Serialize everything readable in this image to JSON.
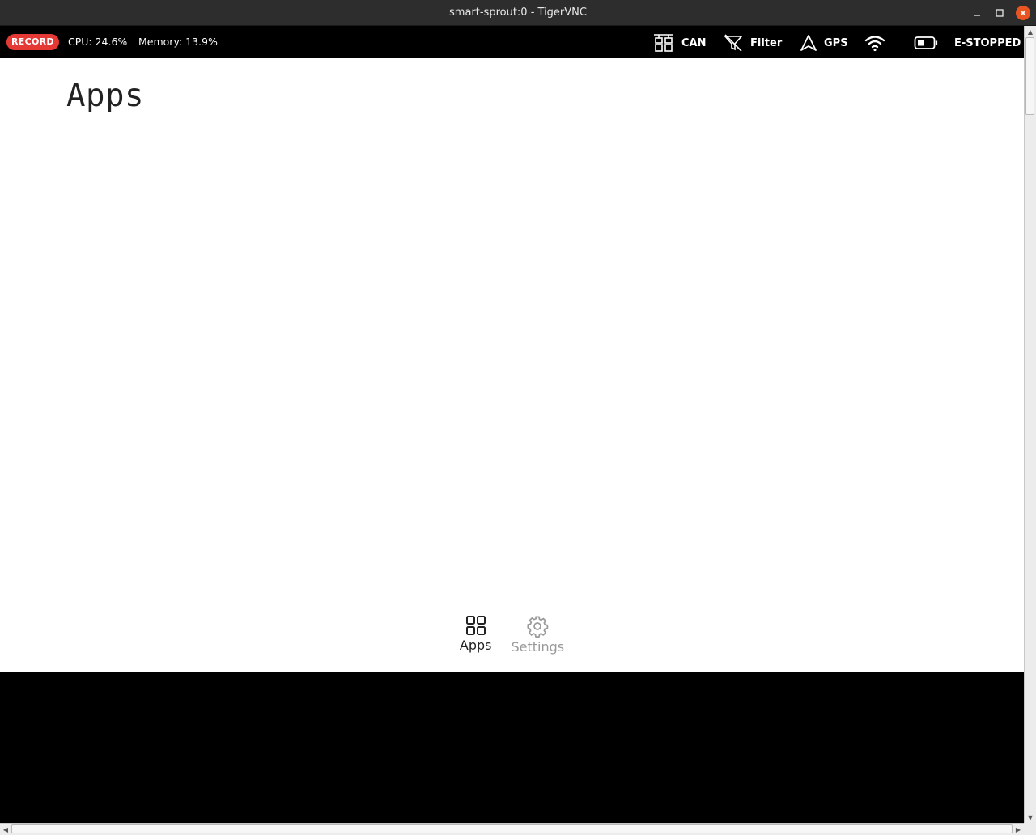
{
  "window": {
    "title": "smart-sprout:0 - TigerVNC"
  },
  "status_bar": {
    "record_label": "RECORD",
    "cpu_text": "CPU: 24.6%",
    "memory_text": "Memory: 13.9%",
    "items": [
      {
        "icon": "can-bus-icon",
        "label": "CAN"
      },
      {
        "icon": "filter-off-icon",
        "label": "Filter"
      },
      {
        "icon": "gps-navigation-icon",
        "label": "GPS"
      },
      {
        "icon": "wifi-icon",
        "label": ""
      },
      {
        "icon": "battery-icon",
        "label": "E-STOPPED"
      }
    ]
  },
  "main": {
    "page_title": "Apps"
  },
  "bottom_nav": {
    "items": [
      {
        "icon": "apps-grid-icon",
        "label": "Apps",
        "active": true
      },
      {
        "icon": "gear-icon",
        "label": "Settings",
        "active": false
      }
    ]
  },
  "colors": {
    "record_badge": "#e53935",
    "close_button": "#e95420",
    "active_nav": "#222222",
    "inactive_nav": "#9a9a9a"
  }
}
